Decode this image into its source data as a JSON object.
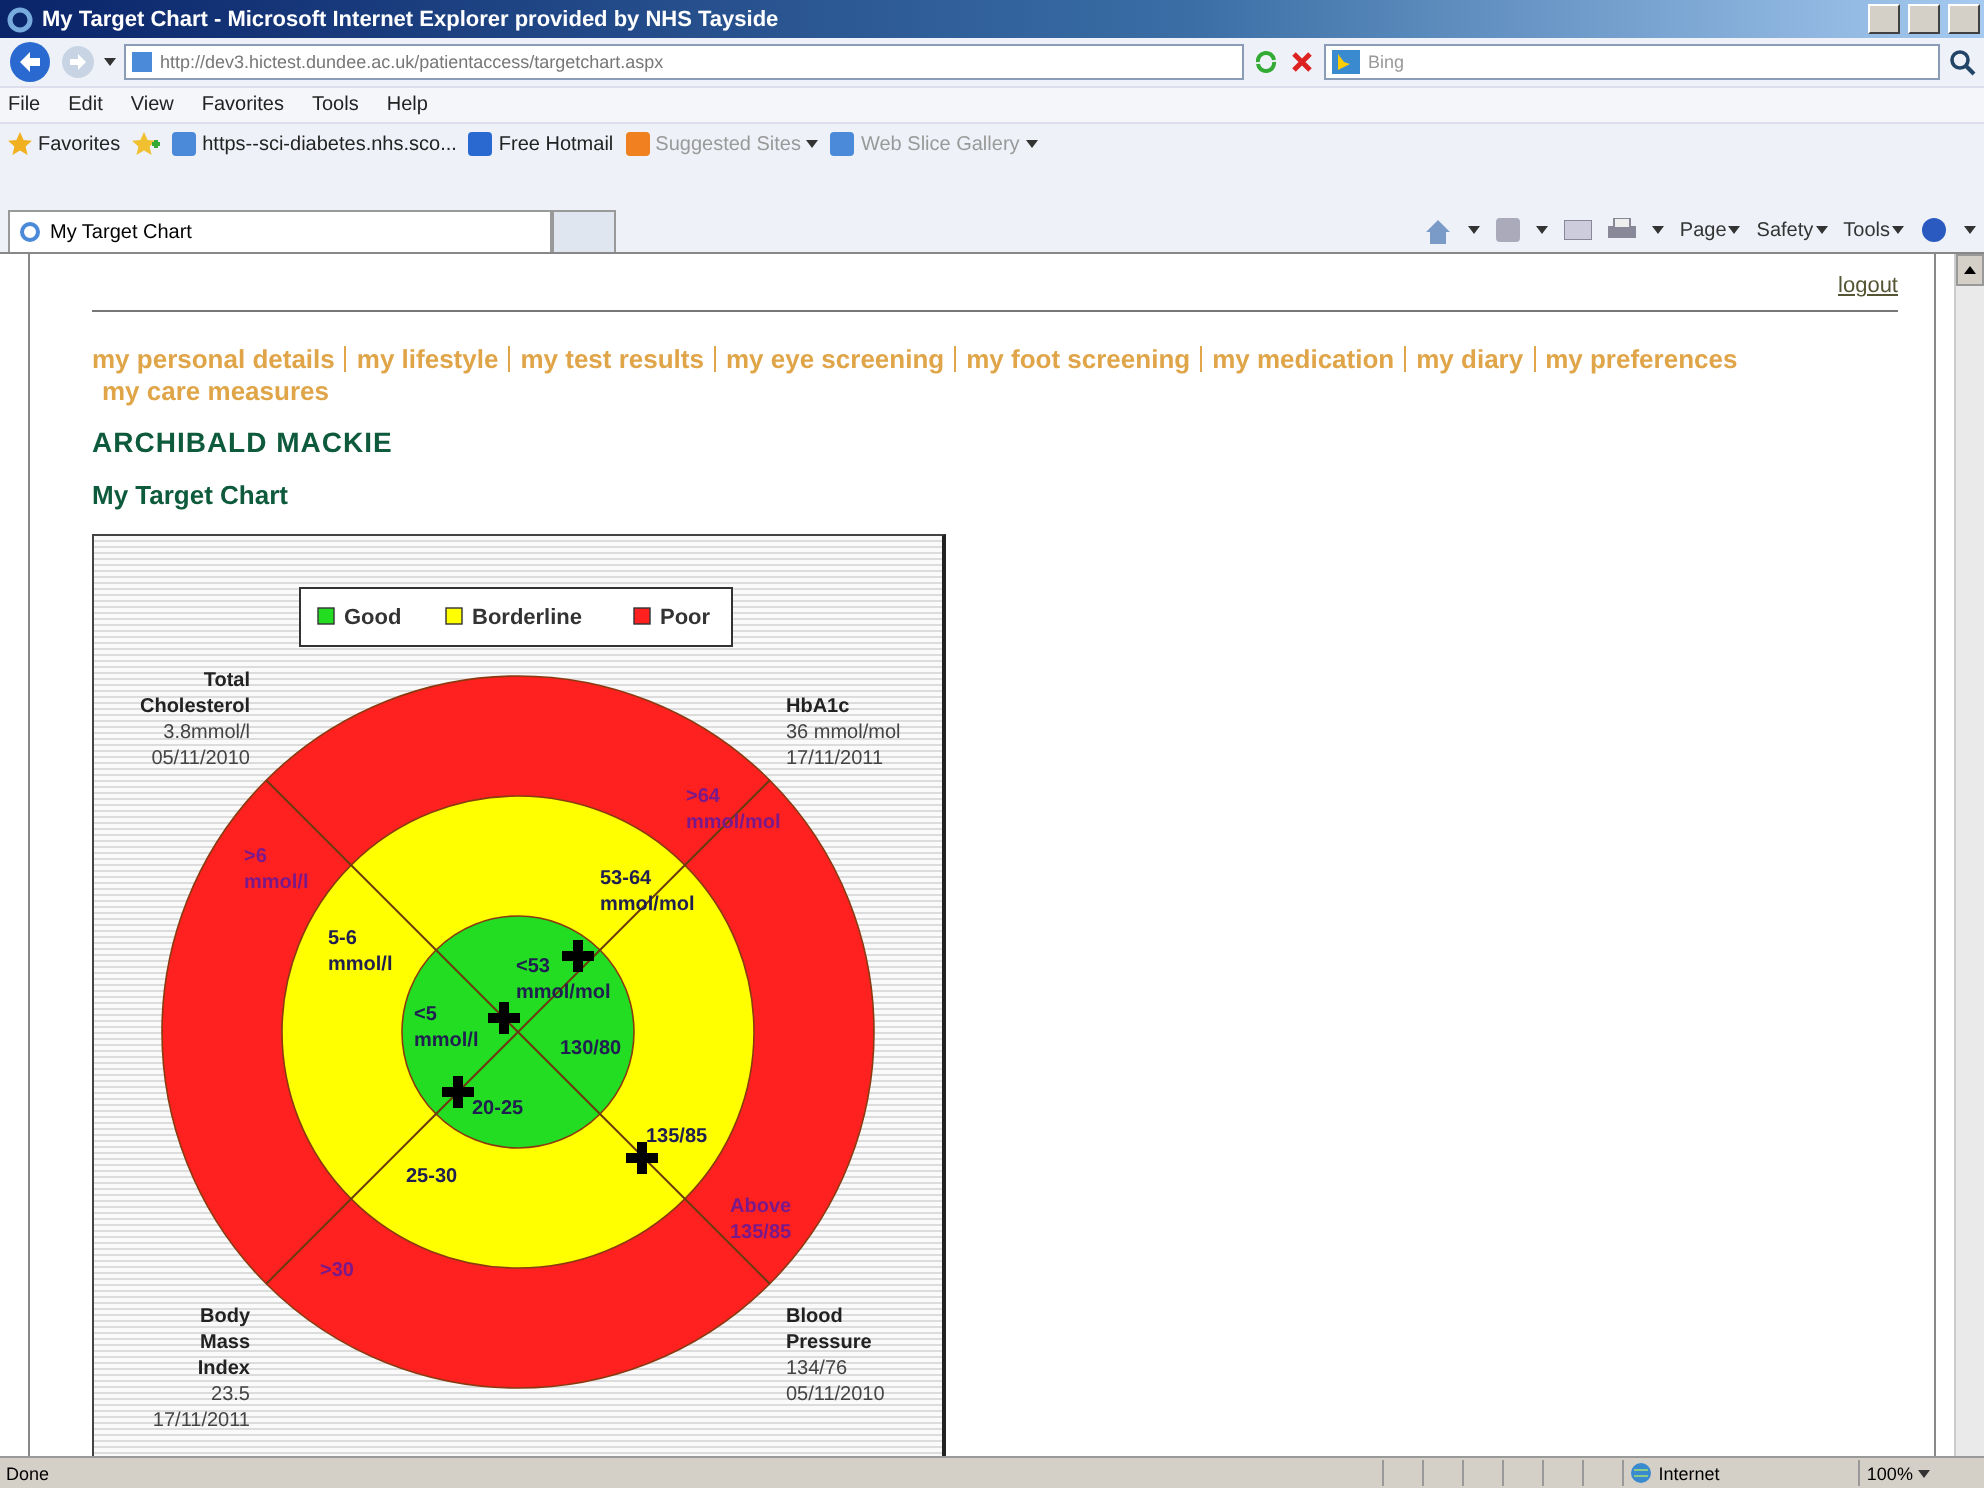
{
  "window": {
    "title": "My Target Chart - Microsoft Internet Explorer provided by NHS Tayside"
  },
  "address_bar": {
    "url": "http://dev3.hictest.dundee.ac.uk/patientaccess/targetchart.aspx"
  },
  "search": {
    "placeholder": "Bing"
  },
  "menu": [
    "File",
    "Edit",
    "View",
    "Favorites",
    "Tools",
    "Help"
  ],
  "favorites_bar": {
    "label": "Favorites",
    "items": [
      "https--sci-diabetes.nhs.sco...",
      "Free Hotmail",
      "Suggested Sites",
      "Web Slice Gallery"
    ]
  },
  "tabs": [
    {
      "title": "My Target Chart",
      "selected": true
    }
  ],
  "command_bar": [
    "Page",
    "Safety",
    "Tools"
  ],
  "page": {
    "logout": "logout",
    "nav": [
      "my personal details",
      "my lifestyle",
      "my test results",
      "my eye screening",
      "my foot screening",
      "my medication",
      "my diary",
      "my preferences",
      "my care measures"
    ],
    "patient": "ARCHIBALD MACKIE",
    "heading": "My Target Chart"
  },
  "chart": {
    "legend": [
      {
        "label": "Good",
        "color": "#22dd22"
      },
      {
        "label": "Borderline",
        "color": "#ffff00"
      },
      {
        "label": "Poor",
        "color": "#ff2020"
      }
    ],
    "measures": [
      {
        "name": "Total Cholesterol",
        "value": "3.8mmol/l",
        "date": "05/11/2010",
        "bands": [
          "<5 mmol/l",
          "5-6 mmol/l",
          ">6 mmol/l"
        ]
      },
      {
        "name": "HbA1c",
        "value": "36 mmol/mol",
        "date": "17/11/2011",
        "bands": [
          "<53 mmol/mol",
          "53-64 mmol/mol",
          ">64 mmol/mol"
        ]
      },
      {
        "name": "Body Mass Index",
        "value": "23.5",
        "date": "17/11/2011",
        "bands": [
          "20-25",
          "25-30",
          ">30"
        ]
      },
      {
        "name": "Blood Pressure",
        "value": "134/76",
        "date": "05/11/2010",
        "bands": [
          "130/80",
          "135/85",
          "Above 135/85"
        ]
      }
    ]
  },
  "status_bar": {
    "text": "Done",
    "zone": "Internet",
    "zoom": "100%"
  }
}
